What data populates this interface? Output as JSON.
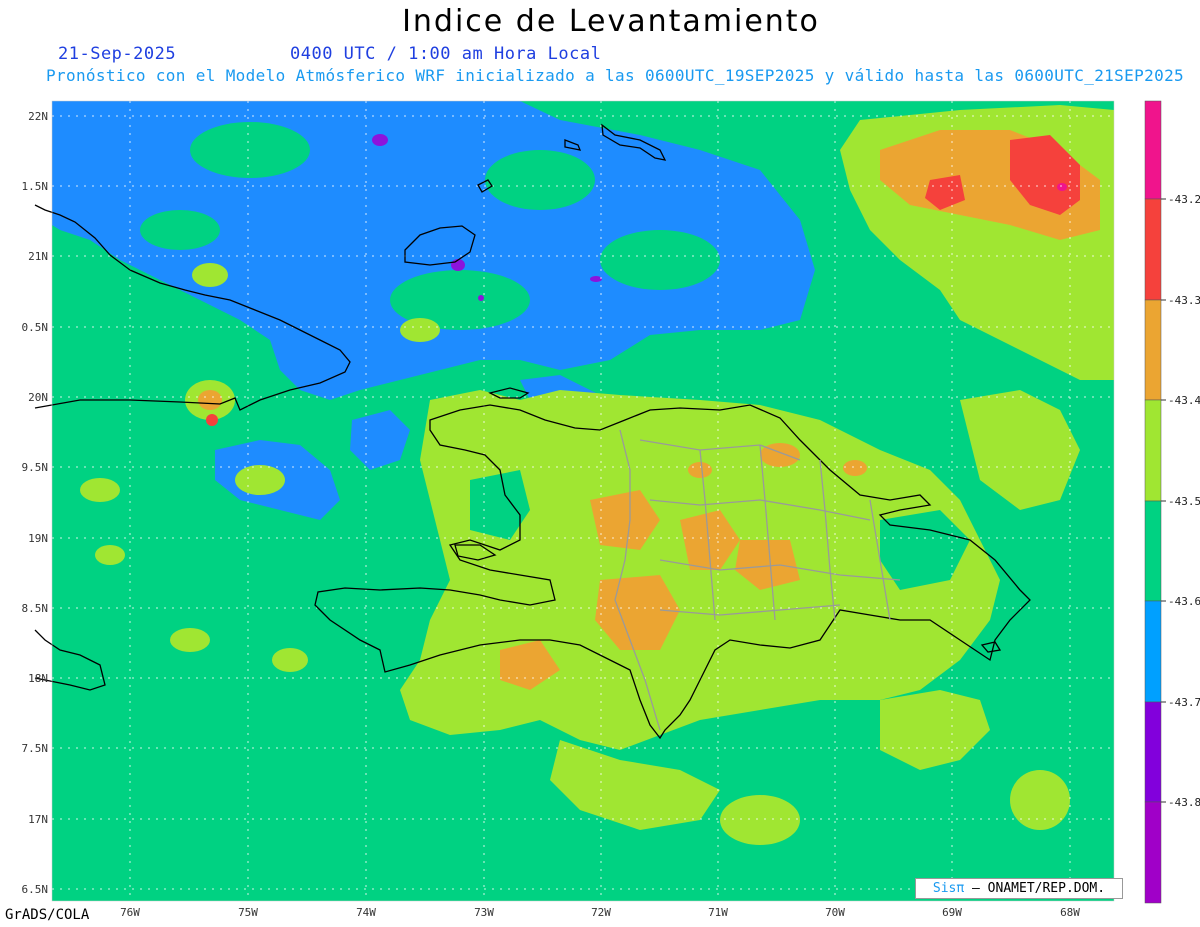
{
  "title": "Indice de Levantamiento",
  "date": "21-Sep-2025",
  "time_label": "0400 UTC / 1:00 am Hora Local",
  "forecast_note": "Pronóstico con el Modelo Atmósferico WRF inicializado a las 0600UTC_19SEP2025 y válido hasta las  0600UTC_21SEP2025",
  "credit": {
    "brand": "Sisπ",
    "text": "– ONAMET/REP.DOM."
  },
  "software": "GrADS/COLA",
  "lat_labels": [
    "22N",
    "1.5N",
    "21N",
    "0.5N",
    "20N",
    "9.5N",
    "19N",
    "8.5N",
    "18N",
    "7.5N",
    "17N",
    "6.5N"
  ],
  "lon_labels": [
    "76W",
    "75W",
    "74W",
    "73W",
    "72W",
    "71W",
    "70W",
    "69W",
    "68W"
  ],
  "colorbar": {
    "labels": [
      "-43.2",
      "-43.3",
      "-43.4",
      "-43.5",
      "-43.6",
      "-43.7",
      "-43.8"
    ],
    "colors": [
      "#f0148c",
      "#f5413c",
      "#eba532",
      "#a0e632",
      "#00d282",
      "#00a0ff",
      "#8200dc",
      "#a000c8"
    ]
  },
  "field_colors": {
    "background": "#00d282",
    "low": "#1e8cff",
    "lowest": "#8c14dc",
    "moderate": "#a0e632",
    "high": "#eba532",
    "higher": "#f5413c",
    "highest": "#f0148c"
  }
}
